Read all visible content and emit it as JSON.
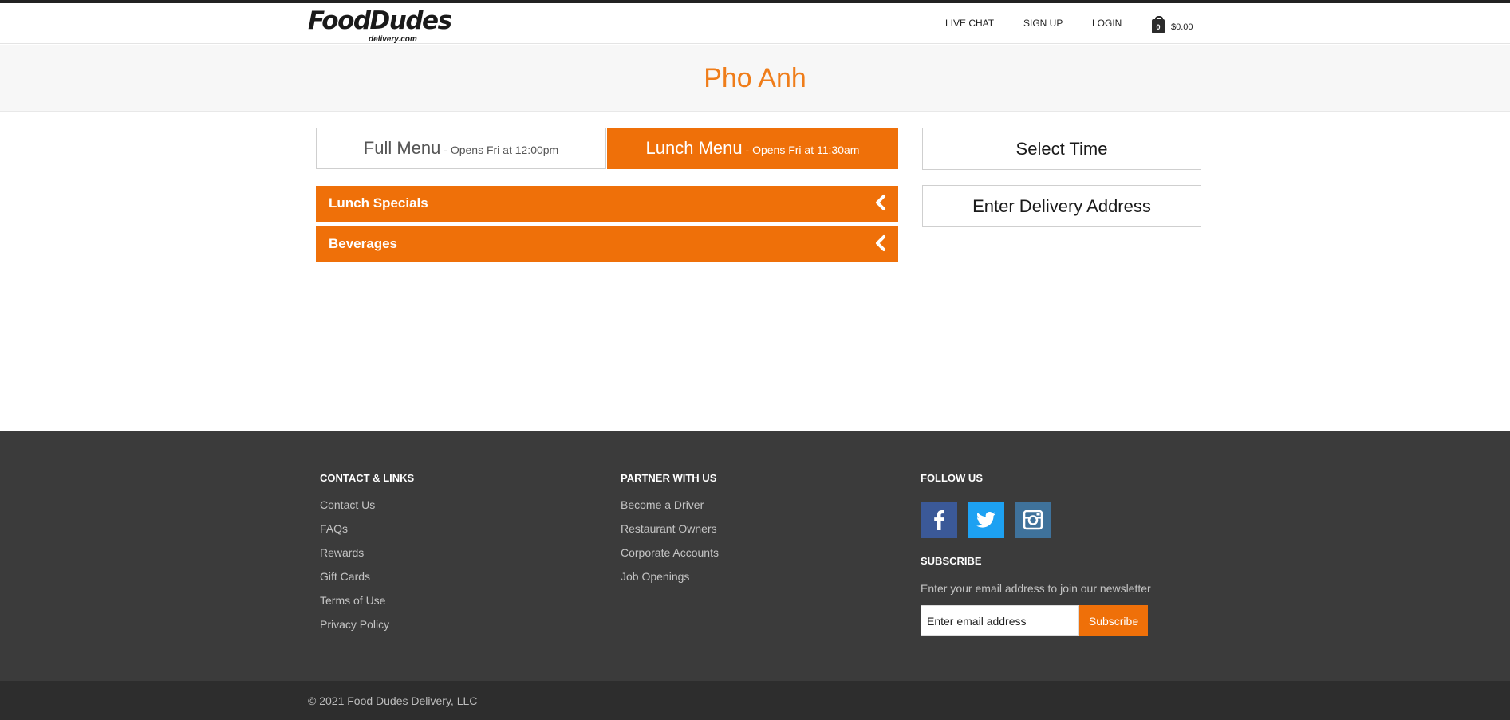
{
  "header": {
    "logo_text": "FoodDudes",
    "logo_sub": "delivery.com",
    "nav": [
      {
        "label": "LIVE CHAT"
      },
      {
        "label": "SIGN UP"
      },
      {
        "label": "LOGIN"
      }
    ],
    "cart_count": "0",
    "cart_total": "$0.00",
    "cart_icon": "shopping-bag-icon"
  },
  "page": {
    "title": "Pho Anh"
  },
  "menu_tabs": [
    {
      "label": "Full Menu",
      "sub": " - Opens Fri at 12:00pm",
      "active": false
    },
    {
      "label": "Lunch Menu",
      "sub": " - Opens Fri at 11:30am",
      "active": true
    }
  ],
  "categories": [
    {
      "label": "Lunch Specials",
      "icon": "chevron-left-icon"
    },
    {
      "label": "Beverages",
      "icon": "chevron-left-icon"
    }
  ],
  "sidebar": {
    "select_time": "Select Time",
    "enter_address": "Enter Delivery Address"
  },
  "footer": {
    "contact": {
      "heading": "CONTACT & LINKS",
      "links": [
        "Contact Us",
        "FAQs",
        "Rewards",
        "Gift Cards",
        "Terms of Use",
        "Privacy Policy"
      ]
    },
    "partner": {
      "heading": "PARTNER WITH US",
      "links": [
        "Become a Driver",
        "Restaurant Owners",
        "Corporate Accounts",
        "Job Openings"
      ]
    },
    "follow": {
      "heading": "FOLLOW US",
      "icons": [
        "facebook-icon",
        "twitter-icon",
        "instagram-icon"
      ]
    },
    "subscribe": {
      "heading": "SUBSCRIBE",
      "text": "Enter your email address to join our newsletter",
      "placeholder": "Enter email address",
      "button": "Subscribe"
    },
    "copyright": "© 2021 Food Dudes Delivery, LLC"
  },
  "colors": {
    "accent": "#ef7009",
    "title": "#ef7d1a",
    "footer_bg": "#3b3b3b",
    "bottom_bg": "#2d2d2d",
    "facebook": "#3b5998",
    "twitter": "#1da1f2",
    "instagram": "#3f729b"
  }
}
